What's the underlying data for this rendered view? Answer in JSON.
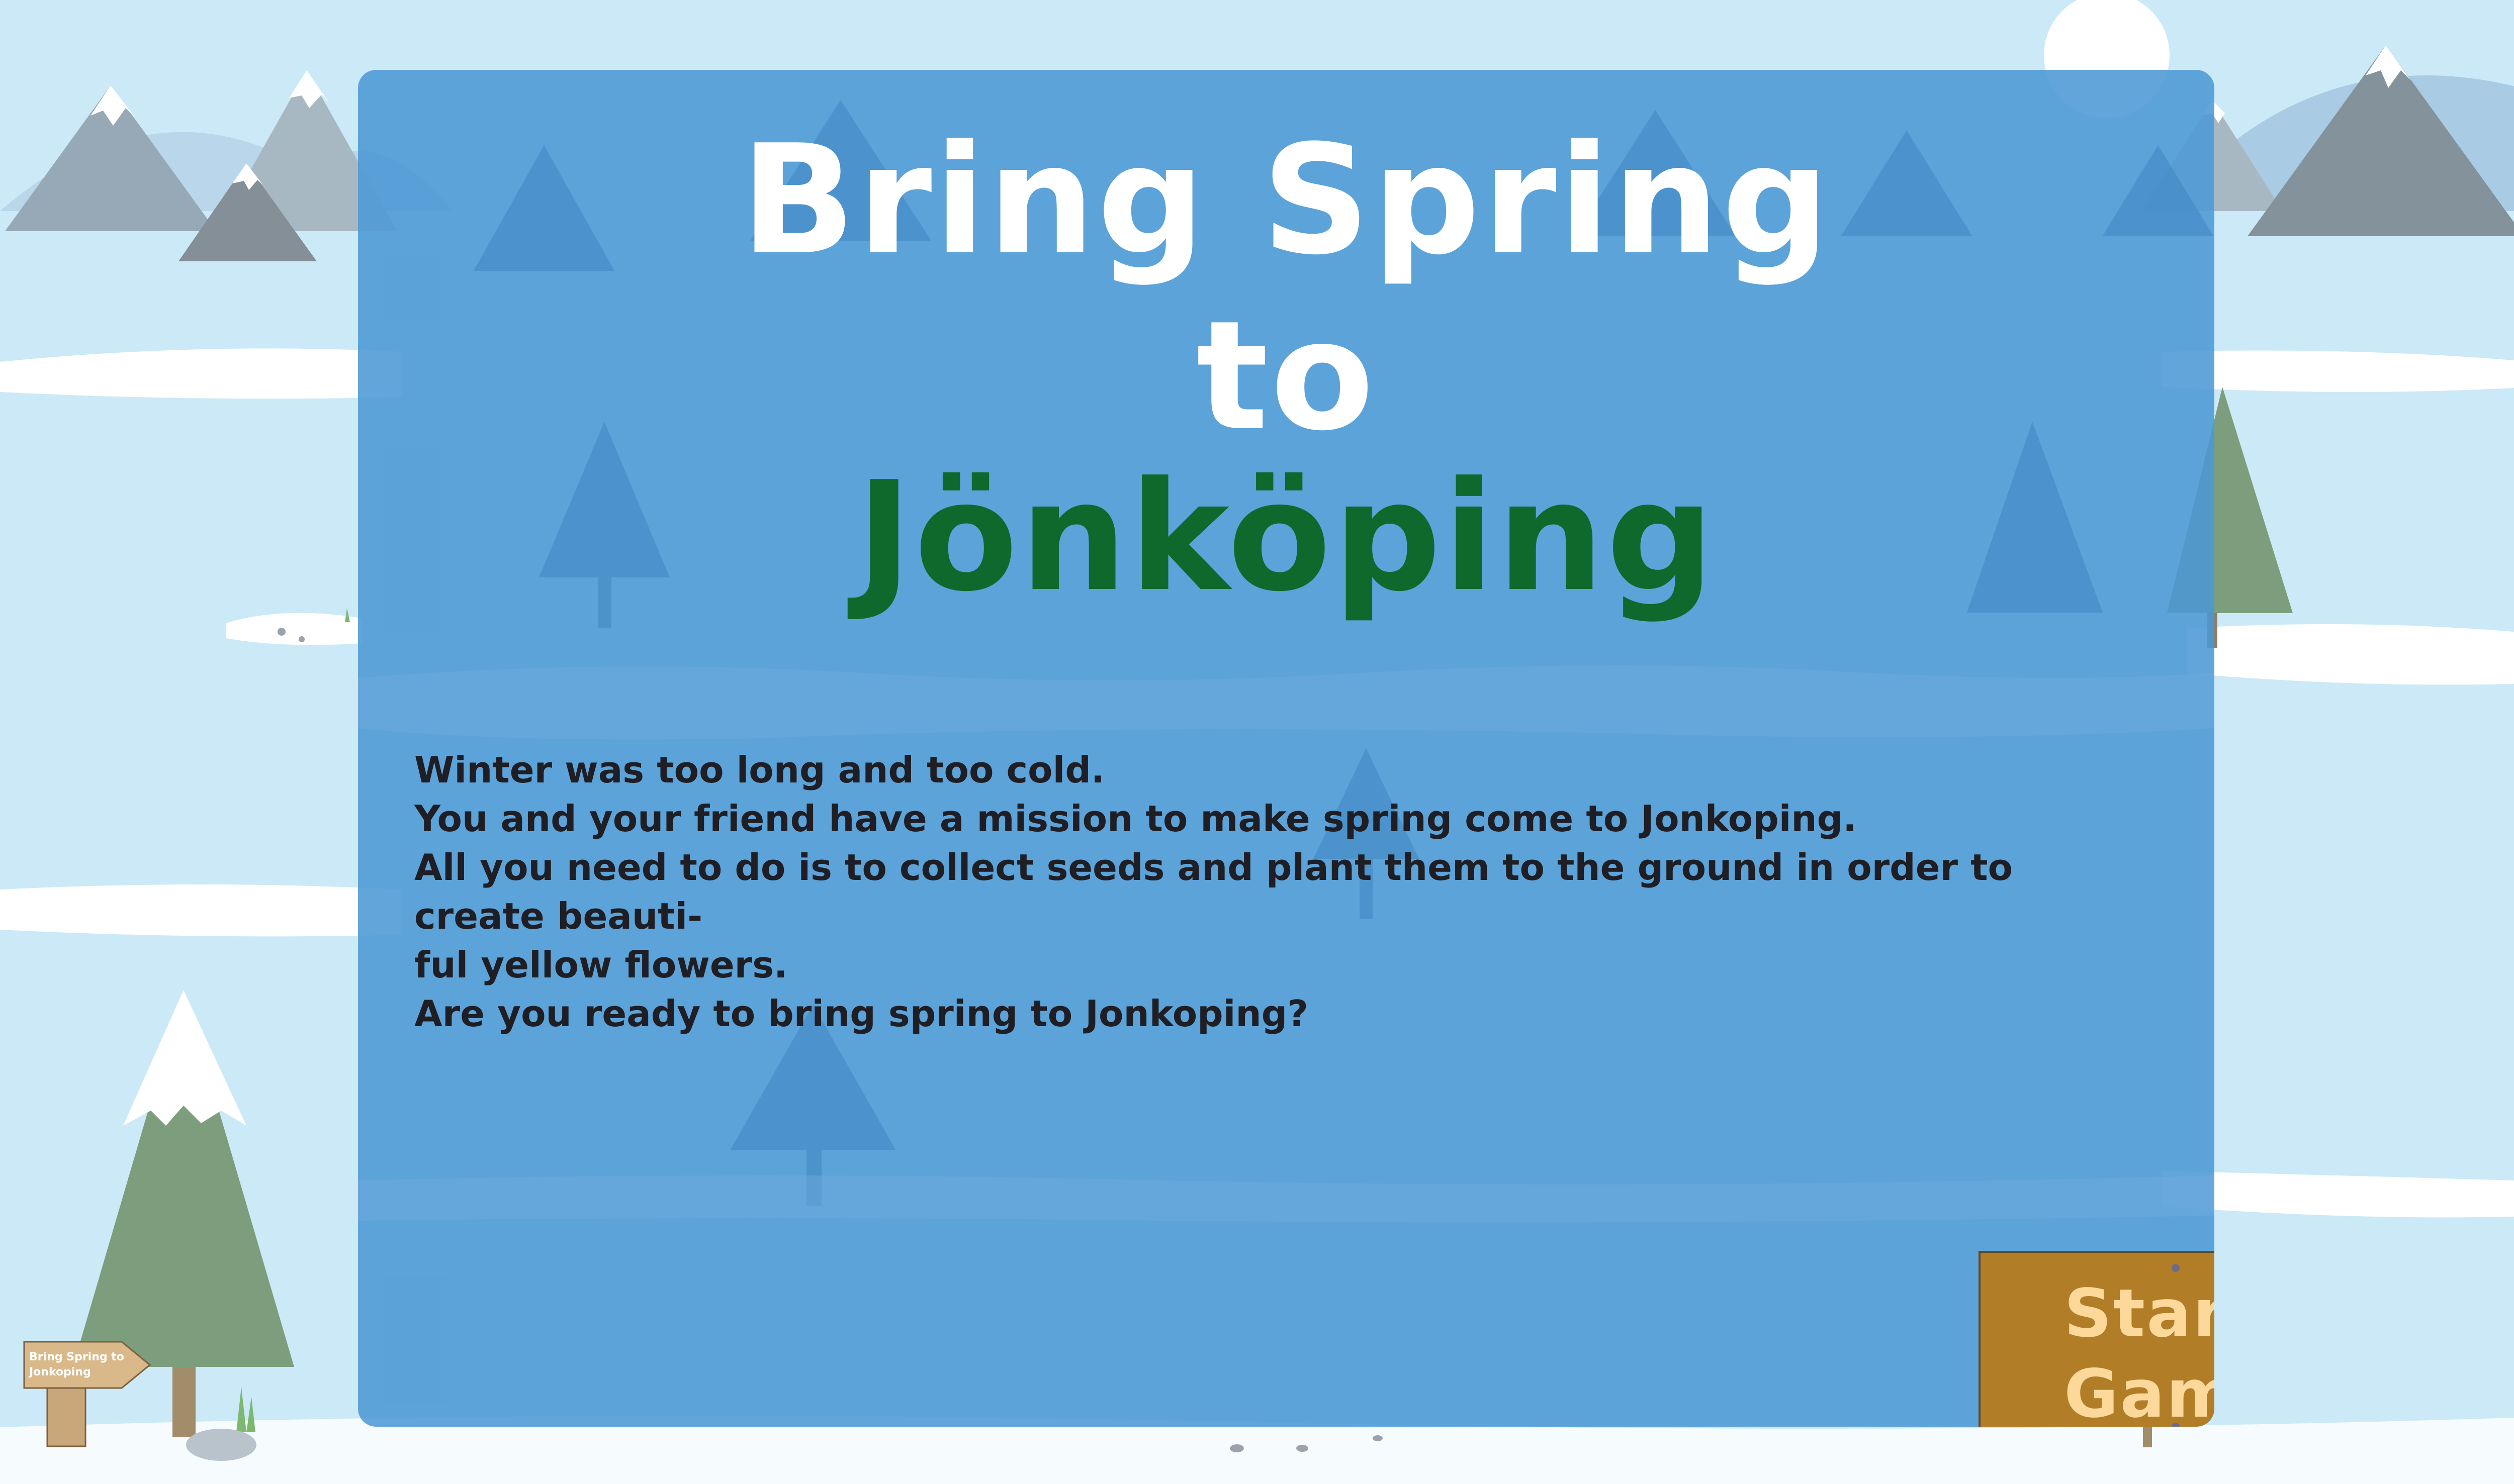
{
  "title": {
    "line_1": "Bring Spring",
    "line_2": "to",
    "line_3": "Jönköping"
  },
  "intro": {
    "lines": [
      "Winter was too long and too cold.",
      "You and your friend have a mission to make spring come to Jonkoping.",
      "All you need to do is to collect seeds and plant them to the ground in order to create beauti-",
      "ful yellow flowers.",
      "Are you ready to bring spring to Jonkoping?"
    ]
  },
  "start_button": {
    "label": "Start the Game"
  },
  "small_sign": {
    "label": "Bring Spring to Jonkoping"
  },
  "colors": {
    "sky": "#cbe9f7",
    "panel": "#4c98d5",
    "title_white": "#ffffff",
    "title_green": "#0e6a2c",
    "sign_wood": "#b17d27",
    "sign_text": "#fcd89b",
    "tree_green": "#7d9e7c",
    "mountain": "#8a9aa6"
  },
  "icons": [
    "mountain-icon",
    "pine-tree-icon",
    "sun-icon",
    "arrow-sign-icon",
    "rock-icon"
  ]
}
